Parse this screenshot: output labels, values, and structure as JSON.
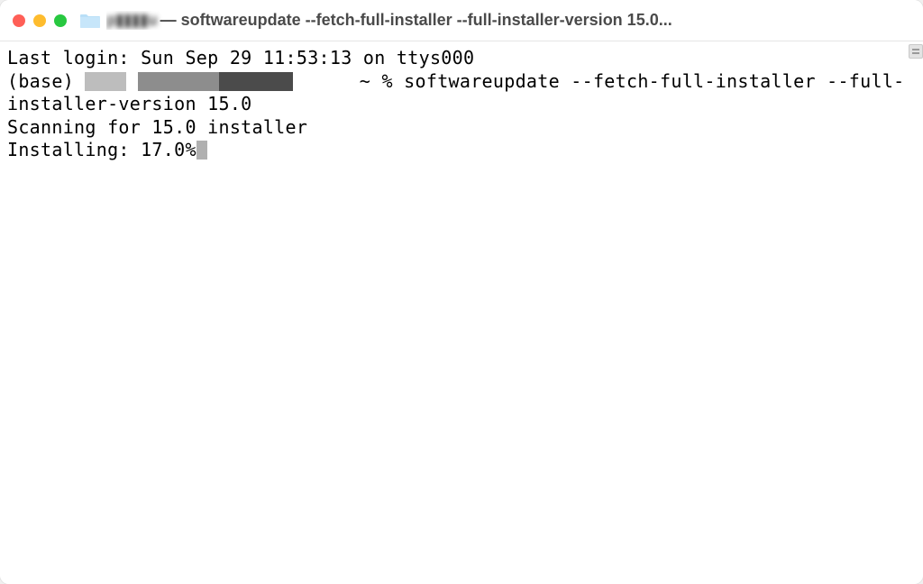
{
  "window": {
    "title_redacted_glyph": "p▮▮▮▮u",
    "title_main": " — softwareupdate --fetch-full-installer --full-installer-version 15.0..."
  },
  "terminal": {
    "last_login_line": "Last login: Sun Sep 29 11:53:13 on ttys000",
    "prompt_prefix": "(base) ",
    "prompt_tilde": " ~ % ",
    "command_part1": "softwareupdate --fetch-full-installer --full-",
    "command_part2": "installer-version 15.0",
    "scan_line": "Scanning for 15.0 installer",
    "install_line": "Installing: 17.0%"
  }
}
